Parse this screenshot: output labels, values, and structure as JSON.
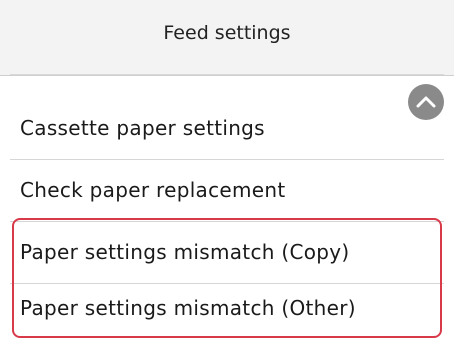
{
  "header": {
    "title": "Feed settings"
  },
  "menu": {
    "items": [
      {
        "label": "Cassette paper settings"
      },
      {
        "label": "Check paper replacement"
      },
      {
        "label": "Paper settings mismatch (Copy)"
      },
      {
        "label": "Paper settings mismatch (Other)"
      }
    ]
  },
  "icons": {
    "scroll_up": "chevron-up-icon"
  },
  "colors": {
    "highlight": "#d83a4a",
    "header_bg": "#f3f3f3",
    "scroll_button": "#8a8a8a"
  }
}
